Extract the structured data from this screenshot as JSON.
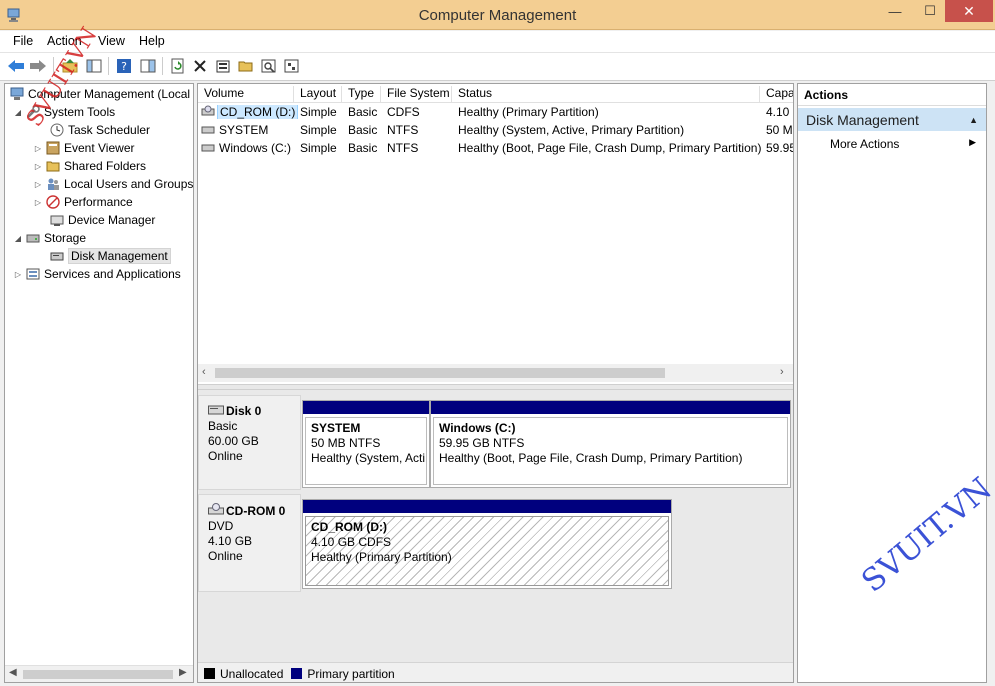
{
  "window": {
    "title": "Computer Management",
    "controls": {
      "minimize": "—",
      "maximize": "☐",
      "close": "✕"
    }
  },
  "menu": [
    "File",
    "Action",
    "View",
    "Help"
  ],
  "toolbar": {
    "buttons": [
      "back-icon",
      "forward-icon",
      "up-folder-icon",
      "console-tree-icon",
      "help-icon",
      "show-hide-icon",
      "refresh-icon",
      "delete-icon",
      "properties-icon",
      "open-icon",
      "search-icon",
      "settings-icon"
    ]
  },
  "tree": {
    "root": "Computer Management (Local",
    "system_tools": "System Tools",
    "task_scheduler": "Task Scheduler",
    "event_viewer": "Event Viewer",
    "shared_folders": "Shared Folders",
    "local_users": "Local Users and Groups",
    "performance": "Performance",
    "device_manager": "Device Manager",
    "storage": "Storage",
    "disk_management": "Disk Management",
    "services": "Services and Applications"
  },
  "volumes": {
    "columns": [
      "Volume",
      "Layout",
      "Type",
      "File System",
      "Status",
      "Capa"
    ],
    "rows": [
      {
        "volume": "CD_ROM (D:)",
        "layout": "Simple",
        "type": "Basic",
        "fs": "CDFS",
        "status": "Healthy (Primary Partition)",
        "capacity": "4.10 ("
      },
      {
        "volume": "SYSTEM",
        "layout": "Simple",
        "type": "Basic",
        "fs": "NTFS",
        "status": "Healthy (System, Active, Primary Partition)",
        "capacity": "50 M"
      },
      {
        "volume": "Windows (C:)",
        "layout": "Simple",
        "type": "Basic",
        "fs": "NTFS",
        "status": "Healthy (Boot, Page File, Crash Dump, Primary Partition)",
        "capacity": "59.95"
      }
    ]
  },
  "disks": [
    {
      "name": "Disk 0",
      "kind": "Basic",
      "size": "60.00 GB",
      "state": "Online",
      "partitions": [
        {
          "name": "SYSTEM",
          "size": "50 MB NTFS",
          "status": "Healthy (System, Acti"
        },
        {
          "name": "Windows  (C:)",
          "size": "59.95 GB NTFS",
          "status": "Healthy (Boot, Page File, Crash Dump, Primary Partition)"
        }
      ]
    },
    {
      "name": "CD-ROM 0",
      "kind": "DVD",
      "size": "4.10 GB",
      "state": "Online",
      "partitions": [
        {
          "name": "CD_ROM  (D:)",
          "size": "4.10 GB CDFS",
          "status": "Healthy (Primary Partition)"
        }
      ]
    }
  ],
  "legend": {
    "unallocated": "Unallocated",
    "primary": "Primary partition",
    "unallocated_color": "#000000",
    "primary_color": "#00007e"
  },
  "actions": {
    "header": "Actions",
    "section": "Disk Management",
    "more": "More Actions"
  },
  "watermarks": {
    "main": "SVUIT.VN",
    "corner": "SVUIT.VN"
  }
}
